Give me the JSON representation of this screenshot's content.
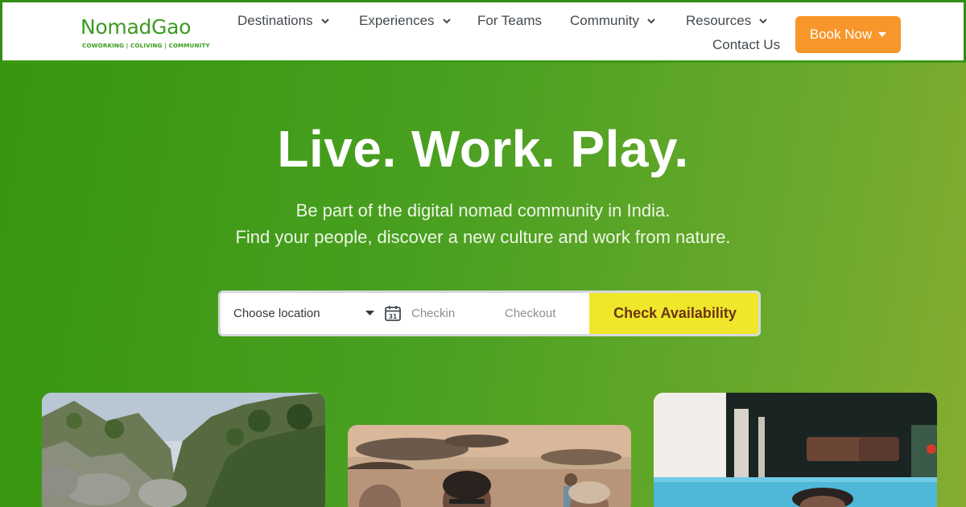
{
  "brand": {
    "name": "NomadGao",
    "tagline": "COWORKING | COLIVING | COMMUNITY"
  },
  "nav": {
    "items": [
      {
        "label": "Destinations",
        "has_dropdown": true
      },
      {
        "label": "Experiences",
        "has_dropdown": true
      },
      {
        "label": "For Teams",
        "has_dropdown": false
      },
      {
        "label": "Community",
        "has_dropdown": true
      },
      {
        "label": "Resources",
        "has_dropdown": true
      },
      {
        "label": "Contact Us",
        "has_dropdown": false
      }
    ],
    "book_label": "Book Now"
  },
  "hero": {
    "title": "Live. Work. Play.",
    "line1": "Be part of the digital nomad community in India.",
    "line2": "Find your people, discover a new culture and work from nature."
  },
  "search": {
    "location_value": "Choose location",
    "checkin_placeholder": "Checkin",
    "checkout_placeholder": "Checkout",
    "button_label": "Check Availability"
  },
  "cards": [
    {
      "name": "mountain-valley-photo"
    },
    {
      "name": "beach-selfie-photo"
    },
    {
      "name": "pool-villa-photo"
    }
  ],
  "colors": {
    "brand_green": "#3c9b22",
    "hero_green": "#4aa021",
    "book_orange": "#f7962b",
    "cta_yellow": "#f0e62a"
  }
}
